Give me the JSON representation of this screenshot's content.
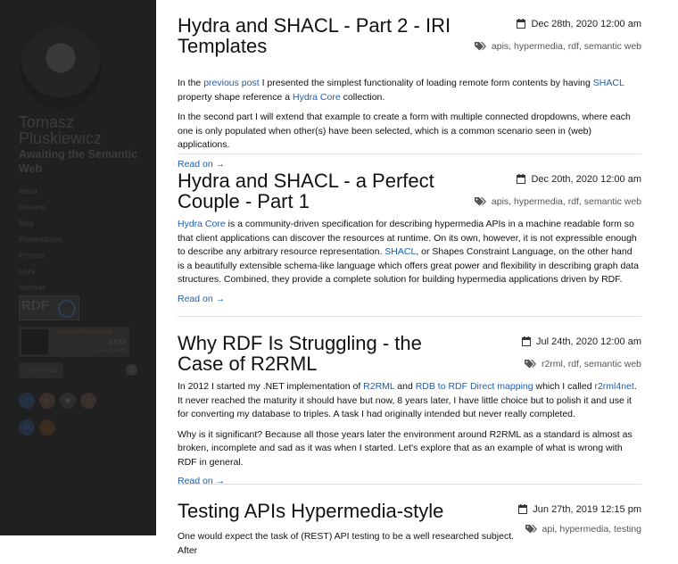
{
  "sidebar": {
    "name": "Tomasz Pluskiewicz",
    "tagline": "Awaiting the Semantic Web",
    "nav": [
      "About",
      "Resume",
      "Blog",
      "Presentations",
      "Projects",
      "Links",
      "Archives"
    ],
    "rdf_badge": "RDF",
    "so_card": {
      "name": "Tomasz Pluskiewicz",
      "reputation": "2,632",
      "badges": "● 1 ● 20 ● 43"
    },
    "open_hub": "Open Hub",
    "open_hub_count": "1"
  },
  "posts": [
    {
      "title": "Hydra and SHACL - Part 2 - IRI Templates",
      "date": "Dec 28th, 2020 12:00 am",
      "tags": "apis, hypermedia, rdf, semantic web",
      "p1": [
        {
          "t": "In the "
        },
        {
          "a": "previous post"
        },
        {
          "t": " I presented the simplest functionality of loading remote form contents by having "
        },
        {
          "a": "SHACL"
        },
        {
          "t": " property shape reference a "
        },
        {
          "a": "Hydra Core"
        },
        {
          "t": " collection."
        }
      ],
      "p2": "In the second part I will extend that example to create a form with multiple connected dropdowns, where each one is only populated when other(s) have been selected, which is a common scenario seen in (web) applications.",
      "readmore": "Read on →"
    },
    {
      "title": "Hydra and SHACL - a Perfect Couple - Part 1",
      "date": "Dec 20th, 2020 12:00 am",
      "tags": "apis, hypermedia, rdf, semantic web",
      "p1": [
        {
          "a": "Hydra Core"
        },
        {
          "t": " is a community-driven specification for describing hypermedia APIs in a machine readable form so that client applications can discover the resources at runtime. On its own, however, it is not expressible enough to describe any arbitrary resource representation. "
        },
        {
          "a": "SHACL"
        },
        {
          "t": ", or Shapes Constraint Language, on the other hand is a beautifully extensible schema-like language which offers great power and flexibility in describing graph data structures. Combined, they provide a complete solution for building hypermedia applications driven by RDF."
        }
      ],
      "p2": "",
      "readmore": "Read on →"
    },
    {
      "title": "Why RDF Is Struggling - the Case of R2RML",
      "date": "Jul 24th, 2020 12:00 am",
      "tags": "r2rml, rdf, semantic web",
      "p1": [
        {
          "t": "In 2012 I started my .NET implementation of "
        },
        {
          "a": "R2RML"
        },
        {
          "t": " and "
        },
        {
          "a": "RDB to RDF Direct mapping"
        },
        {
          "t": " which I called "
        },
        {
          "a": "r2rml4net"
        },
        {
          "t": ". It never reached the maturity it should have but now, 8 years later, I have little choice but to polish it and use it for converting my database to triples. A task I had originally intended but never really completed."
        }
      ],
      "p2": "Why is it significant? Because all those years later the environment around R2RML as a standard is almost as broken, incomplete and sad as it was when I started. Let's explore that as an example of what is wrong with RDF in general.",
      "readmore": "Read on →"
    },
    {
      "title": "Testing APIs Hypermedia-style",
      "date": "Jun 27th, 2019 12:15 pm",
      "tags": "api, hypermedia, testing",
      "p1": [
        {
          "t": "One would expect the task of (REST) API testing to be a well researched subject. After"
        }
      ],
      "p2": "",
      "readmore": ""
    }
  ]
}
